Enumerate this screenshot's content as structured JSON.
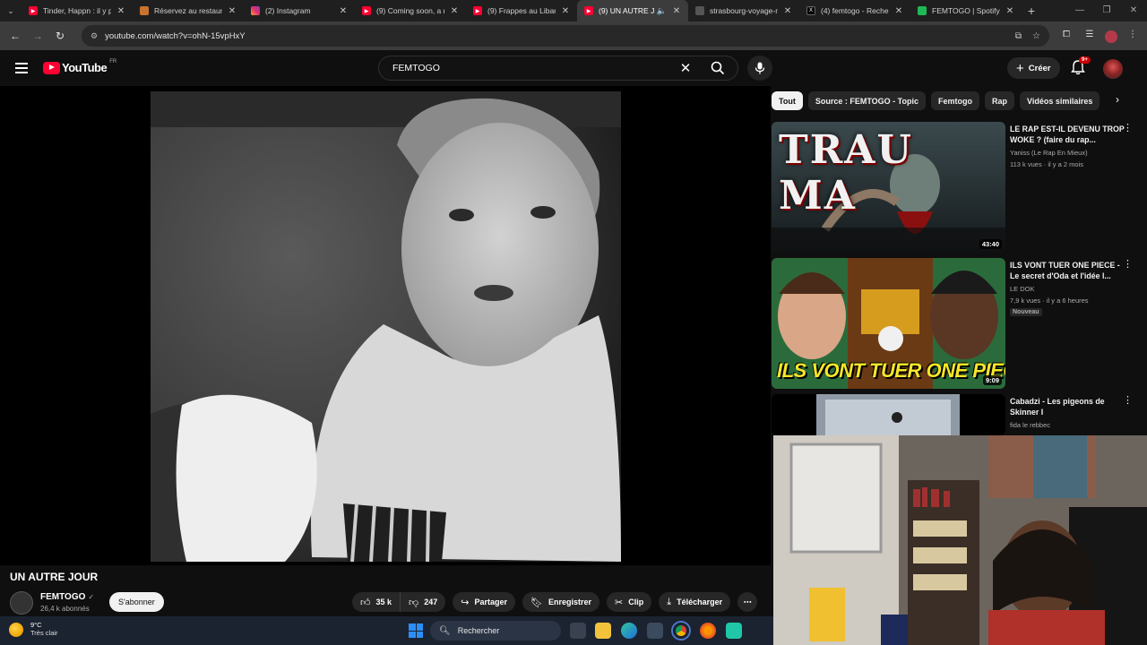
{
  "browser": {
    "tabs": [
      {
        "title": "Tinder, Happn : il y p",
        "icon": "youtube-icon",
        "active": false
      },
      {
        "title": "Réservez au restaurant",
        "icon": "restaurant-icon",
        "active": false
      },
      {
        "title": "(2) Instagram",
        "icon": "instagram-icon",
        "active": false
      },
      {
        "title": "(9) Coming soon, a m",
        "icon": "youtube-icon",
        "active": false
      },
      {
        "title": "(9) Frappes au Liban",
        "icon": "youtube-icon",
        "active": false
      },
      {
        "title": "(9) UN AUTRE JOU",
        "icon": "youtube-icon",
        "active": true
      },
      {
        "title": "strasbourg-voyage-m",
        "icon": "site-icon",
        "active": false
      },
      {
        "title": "(4) femtogo - Recher",
        "icon": "x-icon",
        "active": false
      },
      {
        "title": "FEMTOGO | Spotify",
        "icon": "spotify-icon",
        "active": false
      }
    ],
    "url": "youtube.com/watch?v=ohN-15vpHxY"
  },
  "youtube": {
    "logo_text": "YouTube",
    "logo_country": "FR",
    "search_value": "FEMTOGO",
    "create_label": "Créer",
    "notification_count": "9+"
  },
  "video": {
    "title": "UN AUTRE JOUR",
    "channel": "FEMTOGO",
    "subscribers": "26,4 k abonnés",
    "subscribe_label": "S'abonner",
    "likes": "35 k",
    "dislikes": "247",
    "share_label": "Partager",
    "save_label": "Enregistrer",
    "clip_label": "Clip",
    "download_label": "Télécharger"
  },
  "chips": [
    "Tout",
    "Source : FEMTOGO - Topic",
    "Femtogo",
    "Rap",
    "Vidéos similaires"
  ],
  "recommendations": [
    {
      "title": "LE RAP EST-IL DEVENU TROP WOKE ? (faire du rap...",
      "channel": "Yaniss (Le Rap En Mieux)",
      "meta": "113 k vues · il y a 2 mois",
      "duration": "43:40",
      "thumb_text": "TRAU MA",
      "badge": ""
    },
    {
      "title": "ILS VONT TUER ONE PIECE - Le secret d'Oda et l'idée l...",
      "channel": "LE DOK",
      "meta": "7,9 k vues · il y a 6 heures",
      "duration": "9:09",
      "thumb_text": "ILS VONT TUER ONE PIECE",
      "badge": "Nouveau"
    },
    {
      "title": "Cabadzi - Les pigeons de Skinner I",
      "channel": "fida le rebbec",
      "meta": "",
      "duration": "",
      "thumb_text": "",
      "badge": ""
    }
  ],
  "taskbar": {
    "temperature": "9°C",
    "condition": "Très clair",
    "search_label": "Rechercher"
  },
  "colors": {
    "background": "#0f0f0f",
    "youtube_red": "#ff0033",
    "chip_active": "#f1f1f1",
    "taskbar": "#1b2330"
  }
}
